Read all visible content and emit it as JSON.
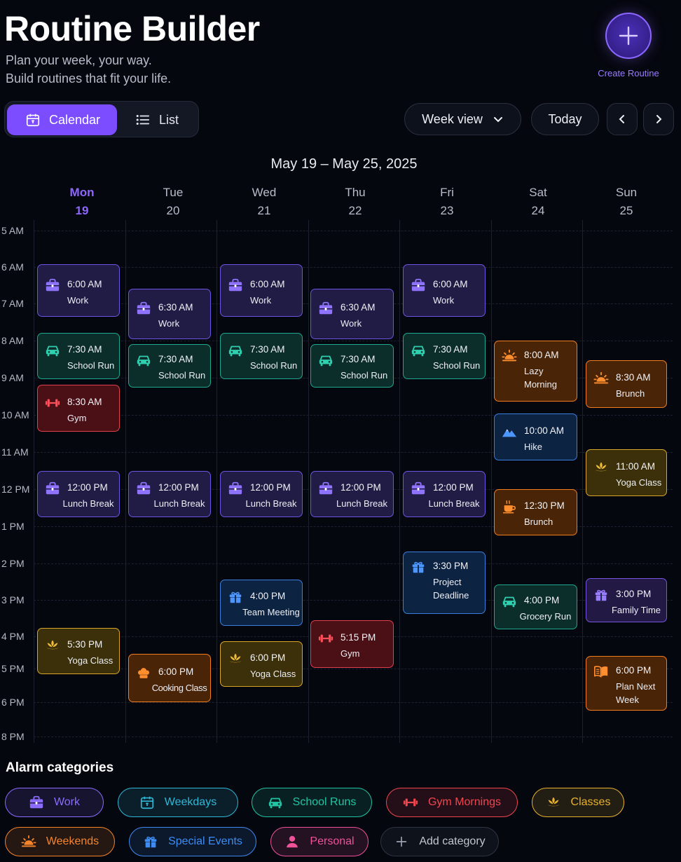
{
  "header": {
    "title": "Routine Builder",
    "subtitle_line1": "Plan your week, your way.",
    "subtitle_line2": "Build routines that fit your life.",
    "create_label": "Create Routine"
  },
  "view_toggle": {
    "calendar_label": "Calendar",
    "list_label": "List",
    "selected": "Calendar"
  },
  "toolbar": {
    "view_select": "Week view",
    "today_label": "Today"
  },
  "range_title": "May 19 – May 25, 2025",
  "days": [
    {
      "name": "Mon",
      "date": "19",
      "today": true
    },
    {
      "name": "Tue",
      "date": "20"
    },
    {
      "name": "Wed",
      "date": "21"
    },
    {
      "name": "Thu",
      "date": "22"
    },
    {
      "name": "Fri",
      "date": "23"
    },
    {
      "name": "Sat",
      "date": "24"
    },
    {
      "name": "Sun",
      "date": "25"
    }
  ],
  "time_labels": [
    "5 AM",
    "6 AM",
    "7 AM",
    "8 AM",
    "9 AM",
    "10 AM",
    "11 AM",
    "12 PM",
    "1 PM",
    "2 PM",
    "3 PM",
    "4 PM",
    "5 PM",
    "6 PM",
    "8 PM"
  ],
  "events": [
    {
      "day": 0,
      "time": "6:00 AM",
      "name": "Work",
      "category": "work",
      "icon": "briefcase-icon"
    },
    {
      "day": 0,
      "time": "7:30 AM",
      "name": "School Run",
      "category": "school",
      "icon": "car-icon"
    },
    {
      "day": 0,
      "time": "8:30 AM",
      "name": "Gym",
      "category": "gym",
      "icon": "dumbbell-icon"
    },
    {
      "day": 0,
      "time": "12:00 PM",
      "name": "Lunch Break",
      "category": "work",
      "icon": "briefcase-icon"
    },
    {
      "day": 0,
      "time": "5:30 PM",
      "name": "Yoga Class",
      "category": "yoga",
      "icon": "lotus-icon"
    },
    {
      "day": 1,
      "time": "6:30 AM",
      "name": "Work",
      "category": "work",
      "icon": "briefcase-icon"
    },
    {
      "day": 1,
      "time": "7:30 AM",
      "name": "School Run",
      "category": "school",
      "icon": "car-icon"
    },
    {
      "day": 1,
      "time": "12:00 PM",
      "name": "Lunch Break",
      "category": "work",
      "icon": "briefcase-icon"
    },
    {
      "day": 1,
      "time": "6:00 PM",
      "name": "Cooking Class",
      "category": "orange",
      "icon": "chef-hat-icon"
    },
    {
      "day": 2,
      "time": "6:00 AM",
      "name": "Work",
      "category": "work",
      "icon": "briefcase-icon"
    },
    {
      "day": 2,
      "time": "7:30 AM",
      "name": "School Run",
      "category": "school",
      "icon": "car-icon"
    },
    {
      "day": 2,
      "time": "12:00 PM",
      "name": "Lunch Break",
      "category": "work",
      "icon": "briefcase-icon"
    },
    {
      "day": 2,
      "time": "4:00 PM",
      "name": "Team Meeting",
      "category": "blue",
      "icon": "gift-icon"
    },
    {
      "day": 2,
      "time": "6:00 PM",
      "name": "Yoga Class",
      "category": "yoga",
      "icon": "lotus-icon"
    },
    {
      "day": 3,
      "time": "6:30 AM",
      "name": "Work",
      "category": "work",
      "icon": "briefcase-icon"
    },
    {
      "day": 3,
      "time": "7:30 AM",
      "name": "School Run",
      "category": "school",
      "icon": "car-icon"
    },
    {
      "day": 3,
      "time": "12:00 PM",
      "name": "Lunch Break",
      "category": "work",
      "icon": "briefcase-icon"
    },
    {
      "day": 3,
      "time": "5:15 PM",
      "name": "Gym",
      "category": "gym",
      "icon": "dumbbell-icon"
    },
    {
      "day": 4,
      "time": "6:00 AM",
      "name": "Work",
      "category": "work",
      "icon": "briefcase-icon"
    },
    {
      "day": 4,
      "time": "7:30 AM",
      "name": "School Run",
      "category": "school",
      "icon": "car-icon"
    },
    {
      "day": 4,
      "time": "12:00 PM",
      "name": "Lunch Break",
      "category": "work",
      "icon": "briefcase-icon"
    },
    {
      "day": 4,
      "time": "3:30 PM",
      "name": "Project Deadline",
      "category": "blue",
      "icon": "gift-icon"
    },
    {
      "day": 5,
      "time": "8:00 AM",
      "name": "Lazy Morning",
      "category": "orange",
      "icon": "sunrise-icon"
    },
    {
      "day": 5,
      "time": "10:00 AM",
      "name": "Hike",
      "category": "blue",
      "icon": "mountain-icon"
    },
    {
      "day": 5,
      "time": "12:30 PM",
      "name": "Brunch",
      "category": "orange",
      "icon": "coffee-icon"
    },
    {
      "day": 5,
      "time": "4:00 PM",
      "name": "Grocery Run",
      "category": "school",
      "icon": "car-icon"
    },
    {
      "day": 6,
      "time": "8:30 AM",
      "name": "Brunch",
      "category": "orange",
      "icon": "sunrise-icon"
    },
    {
      "day": 6,
      "time": "11:00 AM",
      "name": "Yoga Class",
      "category": "yoga",
      "icon": "lotus-icon"
    },
    {
      "day": 6,
      "time": "3:00 PM",
      "name": "Family Time",
      "category": "purple",
      "icon": "gift-icon"
    },
    {
      "day": 6,
      "time": "6:00 PM",
      "name": "Plan Next Week",
      "category": "orange",
      "icon": "book-icon"
    }
  ],
  "categories_title": "Alarm categories",
  "categories": [
    {
      "label": "Work",
      "icon": "briefcase-icon",
      "color": "#8b6cff"
    },
    {
      "label": "Weekdays",
      "icon": "calendar-icon",
      "color": "#2fb8d8"
    },
    {
      "label": "School Runs",
      "icon": "car-icon",
      "color": "#22c4a4"
    },
    {
      "label": "Gym Mornings",
      "icon": "dumbbell-icon",
      "color": "#f0464f"
    },
    {
      "label": "Classes",
      "icon": "lotus-icon",
      "color": "#e7b12d"
    },
    {
      "label": "Weekends",
      "icon": "sunrise-icon",
      "color": "#f5842a"
    },
    {
      "label": "Special Events",
      "icon": "gift-icon",
      "color": "#3d8cf2"
    },
    {
      "label": "Personal",
      "icon": "person-icon",
      "color": "#f0529a"
    },
    {
      "label": "Add category",
      "icon": "plus-icon",
      "color": "#9ea3b2"
    }
  ],
  "colors": {
    "accent": "#7c4dff",
    "background": "#05070f",
    "work": "#6c55e0",
    "school": "#1ea88f",
    "gym": "#e2404e",
    "yoga": "#d9a62a",
    "orange": "#f07d1e",
    "blue": "#3a7fe0"
  }
}
